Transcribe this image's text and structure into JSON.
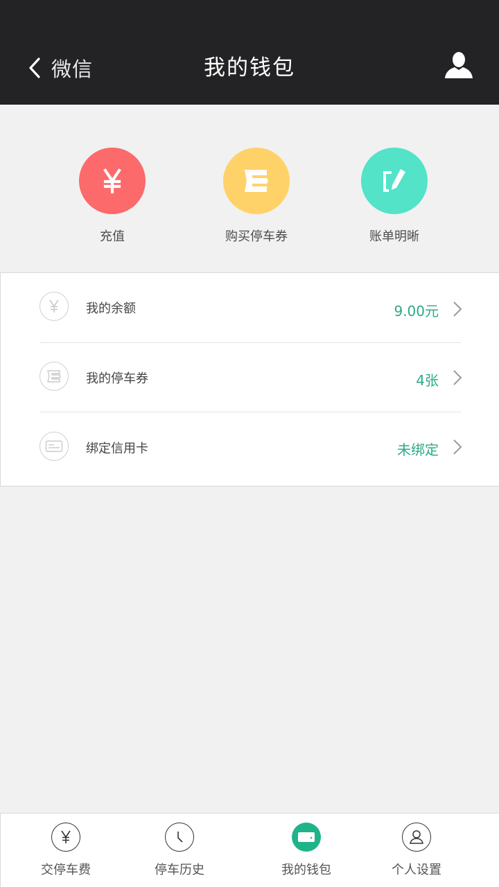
{
  "header": {
    "back_label": "微信",
    "title": "我的钱包"
  },
  "quick_actions": [
    {
      "label": "充值",
      "icon": "yuan-icon",
      "color": "#fc6a6b"
    },
    {
      "label": "购买停车券",
      "icon": "ticket-icon",
      "color": "#ffd269"
    },
    {
      "label": "账单明晰",
      "icon": "edit-icon",
      "color": "#52e3c8"
    }
  ],
  "menu": [
    {
      "label": "我的余额",
      "value": "9.00元",
      "icon": "yuan-icon"
    },
    {
      "label": "我的停车券",
      "value": "4张",
      "icon": "ticket-icon"
    },
    {
      "label": "绑定信用卡",
      "value": "未绑定",
      "icon": "credit-card-icon"
    }
  ],
  "tabs": [
    {
      "label": "交停车费",
      "icon": "yuan-icon",
      "active": false
    },
    {
      "label": "停车历史",
      "icon": "clock-icon",
      "active": false
    },
    {
      "label": "我的钱包",
      "icon": "wallet-icon",
      "active": true
    },
    {
      "label": "个人设置",
      "icon": "user-icon",
      "active": false
    }
  ],
  "colors": {
    "header_bg": "#232325",
    "accent_green": "#2aaa86",
    "active_tab": "#1fb38a"
  }
}
